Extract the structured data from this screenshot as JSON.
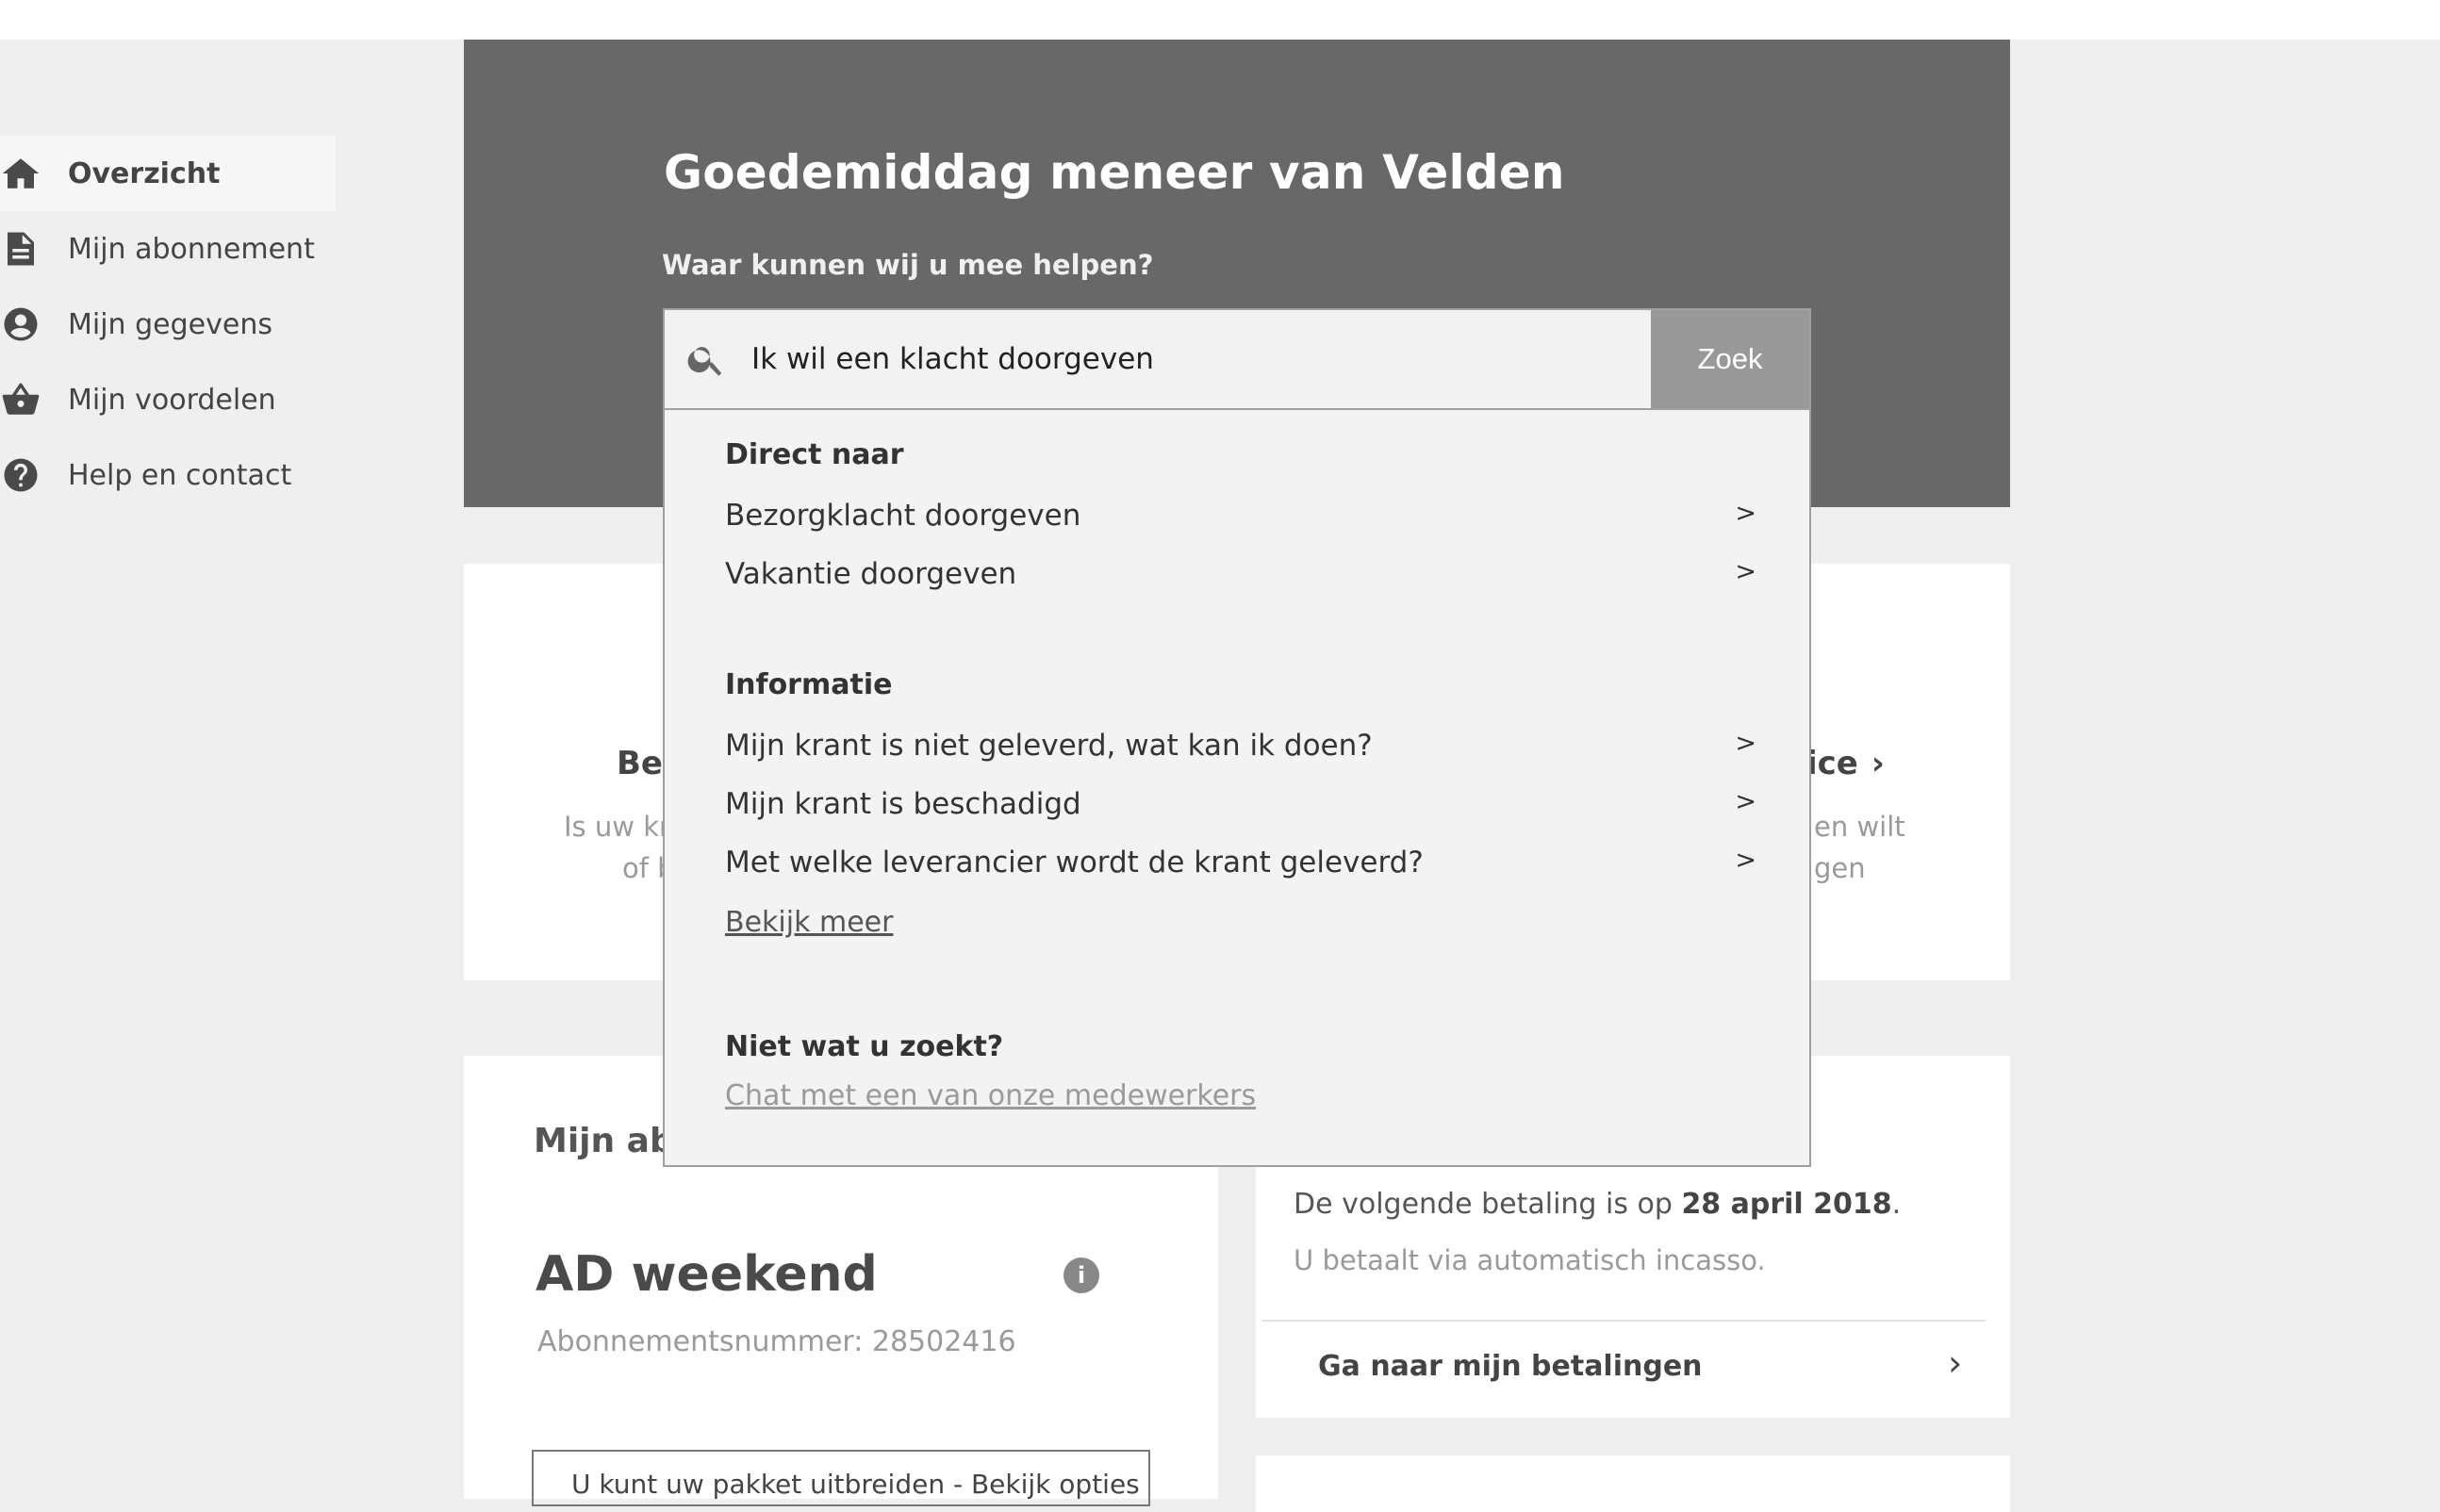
{
  "sidebar": {
    "items": [
      {
        "label": "Overzicht",
        "icon": "home-icon",
        "active": true
      },
      {
        "label": "Mijn abonnement",
        "icon": "document-icon"
      },
      {
        "label": "Mijn gegevens",
        "icon": "user-icon"
      },
      {
        "label": "Mijn voordelen",
        "icon": "basket-icon"
      },
      {
        "label": "Help en contact",
        "icon": "help-icon"
      }
    ]
  },
  "hero": {
    "title": "Goedemiddag meneer van Velden",
    "subtitle": "Waar kunnen wij u mee helpen?"
  },
  "search": {
    "value": "Ik wil een klacht doorgeven",
    "button_label": "Zoek"
  },
  "dropdown": {
    "direct_heading": "Direct naar",
    "direct_items": [
      {
        "label": "Bezorgklacht doorgeven",
        "arrow": ">"
      },
      {
        "label": "Vakantie doorgeven",
        "arrow": ">"
      }
    ],
    "info_heading": "Informatie",
    "info_items": [
      {
        "label": "Mijn krant is niet geleverd, wat kan ik doen?",
        "arrow": ">"
      },
      {
        "label": "Mijn krant is beschadigd",
        "arrow": ">"
      },
      {
        "label": "Met welke leverancier wordt de krant geleverd?",
        "arrow": ">"
      }
    ],
    "more_link": "Bekijk meer",
    "not_found_heading": "Niet wat u zoekt?",
    "chat_link": "Chat met een van onze medewerkers"
  },
  "features": {
    "left_title": "Bez",
    "left_line1": "Is uw kr",
    "left_line2": "of b",
    "right_title": "ice",
    "right_line1": "en wilt",
    "right_line2": "gen"
  },
  "subscription": {
    "heading": "Mijn abo",
    "name": "AD weekend",
    "info_glyph": "i",
    "number": "Abonnementsnummer: 28502416",
    "box_text": "U kunt uw pakket uitbreiden - Bekijk opties"
  },
  "payment": {
    "line1_prefix": "De volgende betaling is op ",
    "line1_date": "28 april 2018",
    "line1_suffix": ".",
    "line2": "U betaalt via automatisch incasso.",
    "link": "Ga naar mijn betalingen"
  }
}
